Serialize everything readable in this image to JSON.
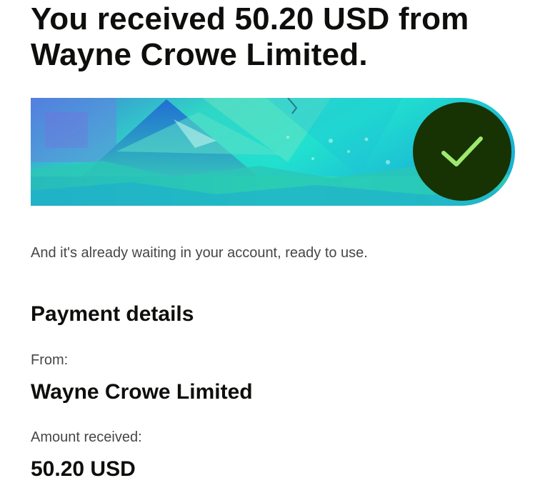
{
  "headline": "You received 50.20 USD from Wayne Crowe Limited.",
  "banner": {
    "image": "mountain-landscape-illustration",
    "status_icon": "checkmark-icon",
    "colors": {
      "badge_bg": "#173303",
      "check": "#9fe870",
      "banner_primary": "#2fd6c6"
    }
  },
  "subtitle": "And it's already waiting in your account, ready to use.",
  "payment_details": {
    "title": "Payment details",
    "from_label": "From:",
    "from_value": "Wayne Crowe Limited",
    "amount_label": "Amount received:",
    "amount_value": "50.20 USD"
  }
}
